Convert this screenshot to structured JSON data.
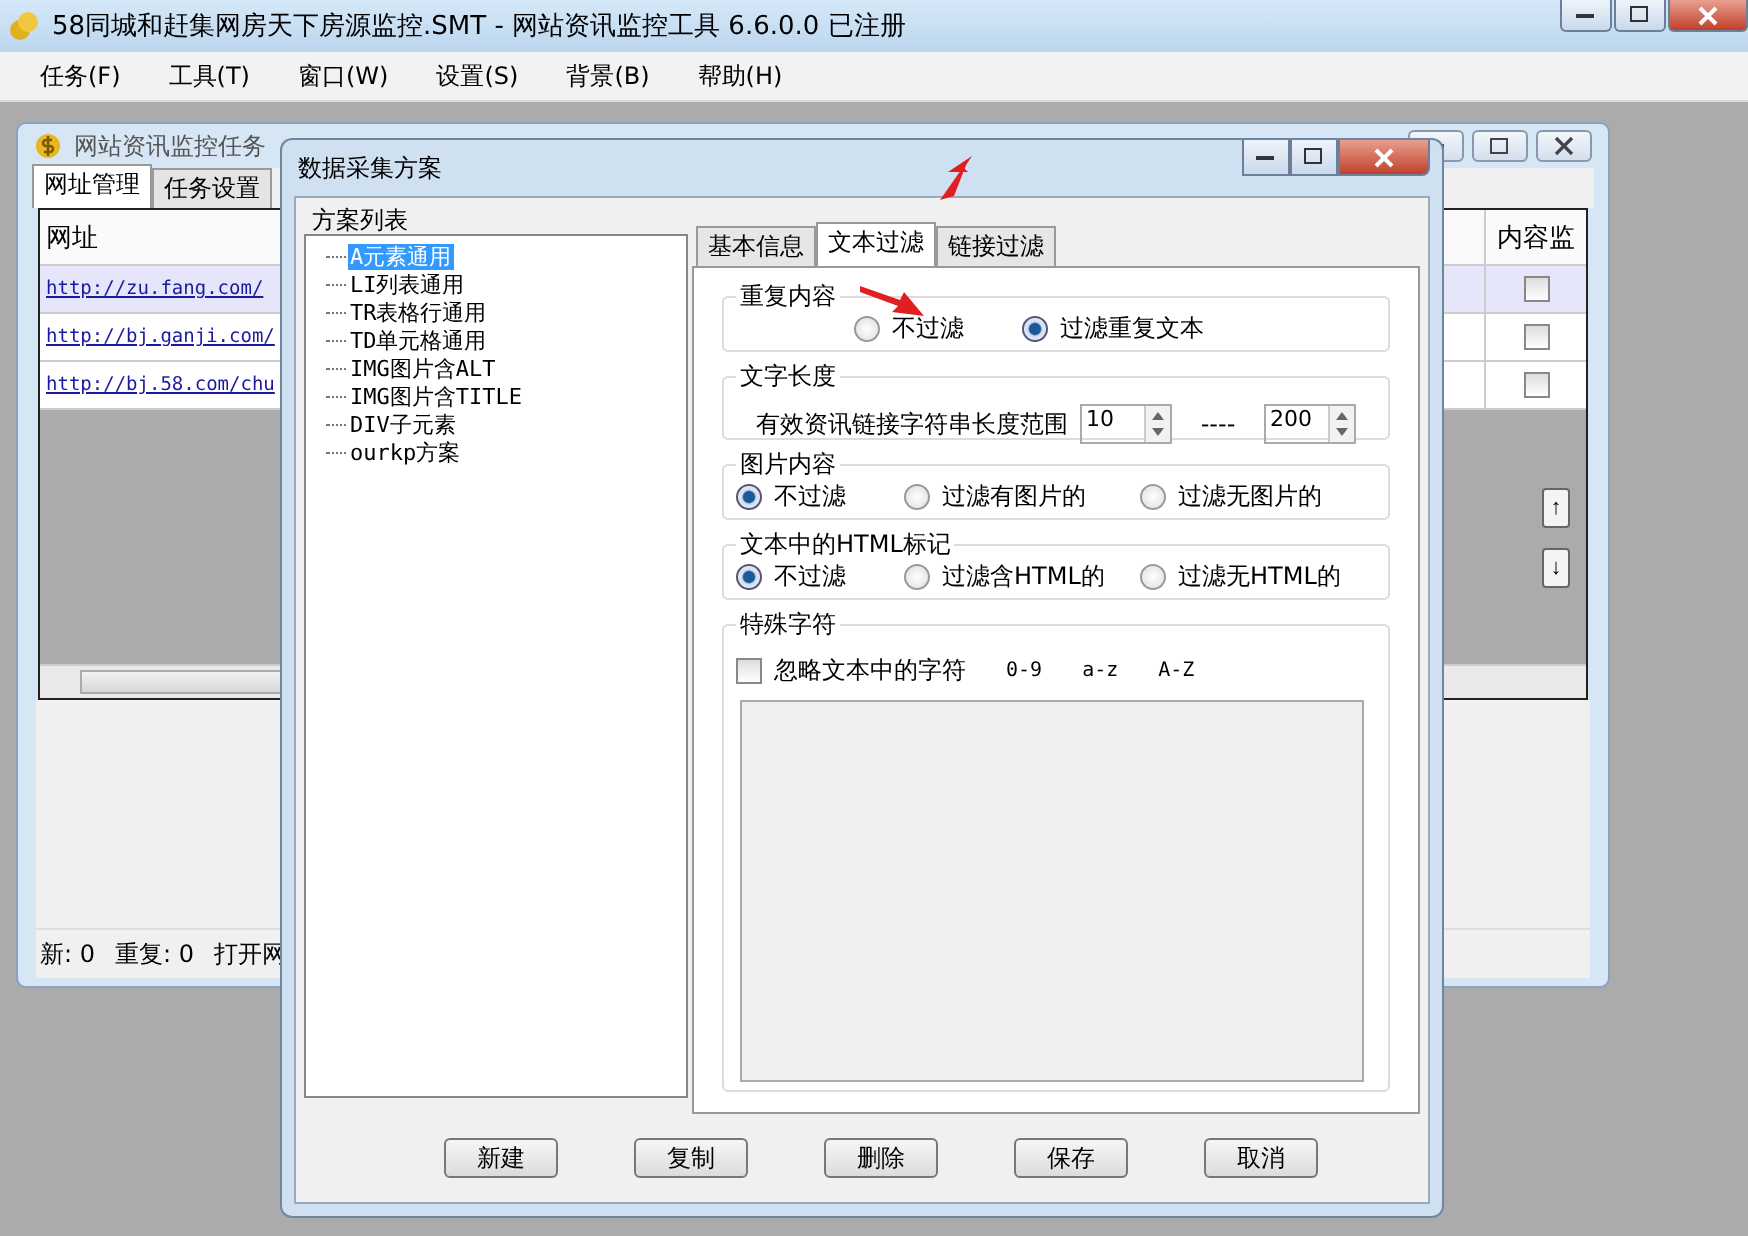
{
  "window": {
    "title": "58同城和赶集网房天下房源监控.SMT  - 网站资讯监控工具 6.6.0.0  已注册"
  },
  "menu": [
    "任务(F)",
    "工具(T)",
    "窗口(W)",
    "设置(S)",
    "背景(B)",
    "帮助(H)"
  ],
  "task_window": {
    "title": "网站资讯监控任务",
    "tabs": [
      {
        "label": "网址管理",
        "selected": true
      },
      {
        "label": "任务设置",
        "selected": false
      }
    ],
    "table": {
      "columns": [
        "网址",
        "内容监"
      ],
      "rows": [
        {
          "url": "http://zu.fang.com/",
          "selected": true,
          "checked": false
        },
        {
          "url": "http://bj.ganji.com/",
          "selected": false,
          "checked": false
        },
        {
          "url": "http://bj.58.com/chu",
          "selected": false,
          "checked": false
        }
      ]
    },
    "move_buttons": [
      "↑",
      "↓"
    ],
    "status": [
      "新: 0",
      "重复: 0",
      "打开网"
    ]
  },
  "dialog": {
    "title": "数据采集方案",
    "scheme_list": {
      "label": "方案列表",
      "items": [
        {
          "label": "A元素通用",
          "selected": true
        },
        {
          "label": "LI列表通用",
          "selected": false
        },
        {
          "label": "TR表格行通用",
          "selected": false
        },
        {
          "label": "TD单元格通用",
          "selected": false
        },
        {
          "label": "IMG图片含ALT",
          "selected": false
        },
        {
          "label": "IMG图片含TITLE",
          "selected": false
        },
        {
          "label": "DIV子元素",
          "selected": false
        },
        {
          "label": "ourkp方案",
          "selected": false
        }
      ]
    },
    "tabs": [
      {
        "label": "基本信息",
        "selected": false
      },
      {
        "label": "文本过滤",
        "selected": true
      },
      {
        "label": "链接过滤",
        "selected": false
      }
    ],
    "groups": [
      {
        "kind": "radios",
        "title": "重复内容",
        "options": [
          {
            "label": "不过滤",
            "selected": false
          },
          {
            "label": "过滤重复文本",
            "selected": true
          }
        ]
      },
      {
        "kind": "range",
        "title": "文字长度",
        "label": "有效资讯链接字符串长度范围",
        "min": "10",
        "separator": "----",
        "max": "200"
      },
      {
        "kind": "radios",
        "title": "图片内容",
        "options": [
          {
            "label": "不过滤",
            "selected": true
          },
          {
            "label": "过滤有图片的",
            "selected": false
          },
          {
            "label": "过滤无图片的",
            "selected": false
          }
        ]
      },
      {
        "kind": "radios",
        "title": "文本中的HTML标记",
        "options": [
          {
            "label": "不过滤",
            "selected": true
          },
          {
            "label": "过滤含HTML的",
            "selected": false
          },
          {
            "label": "过滤无HTML的",
            "selected": false
          }
        ]
      },
      {
        "kind": "chars",
        "title": "特殊字符",
        "label": "忽略文本中的字符",
        "checked": false,
        "tokens": [
          "0-9",
          "a-z",
          "A-Z"
        ]
      }
    ],
    "buttons": [
      "新建",
      "复制",
      "删除",
      "保存",
      "取消"
    ]
  }
}
